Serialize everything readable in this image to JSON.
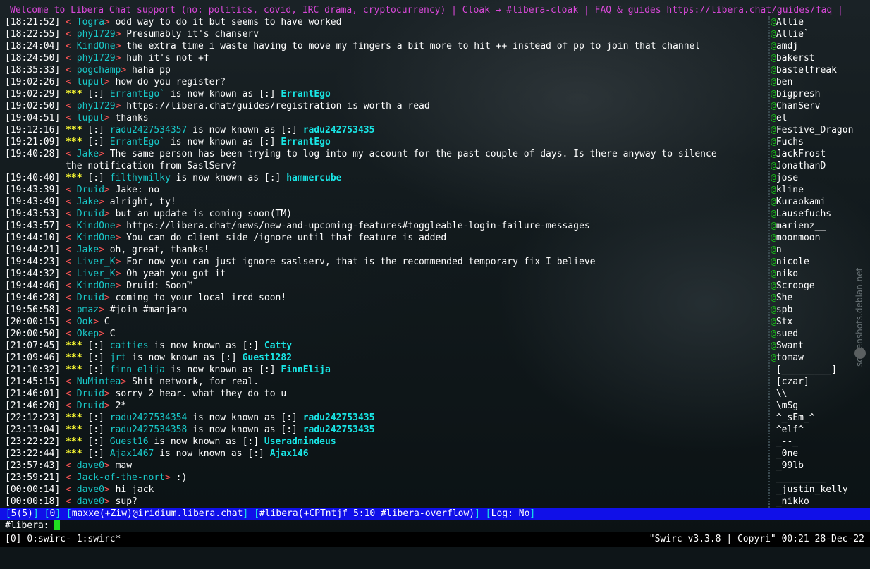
{
  "topic": "Welcome to Libera Chat support (no: politics, covid, IRC drama, cryptocurrency) | Cloak → #libera-cloak | FAQ & guides https://libera.chat/guides/faq |",
  "messages": [
    {
      "ts": "[18:21:52]",
      "kind": "msg",
      "nick": "Togra",
      "text": "odd way to do it but seems to have worked"
    },
    {
      "ts": "[18:22:55]",
      "kind": "msg",
      "nick": "phy1729",
      "text": "Presumably it's chanserv"
    },
    {
      "ts": "[18:24:04]",
      "kind": "msg",
      "nick": "KindOne",
      "text": "the extra time i waste having to move my fingers a bit more to hit ++ instead of pp to join that channel"
    },
    {
      "ts": "[18:24:50]",
      "kind": "msg",
      "nick": "phy1729",
      "text": "huh it's not +f"
    },
    {
      "ts": "[18:35:33]",
      "kind": "msg",
      "nick": "pogchamp",
      "text": "haha pp"
    },
    {
      "ts": "[19:02:26]",
      "kind": "msg",
      "nick": "lupul",
      "text": "how do you register?"
    },
    {
      "ts": "[19:02:29]",
      "kind": "nickchange",
      "old": "ErrantEgo`",
      "new": "ErrantEgo"
    },
    {
      "ts": "[19:02:50]",
      "kind": "msg",
      "nick": "phy1729",
      "text": "https://libera.chat/guides/registration is worth a read"
    },
    {
      "ts": "[19:04:51]",
      "kind": "msg",
      "nick": "lupul",
      "text": "thanks"
    },
    {
      "ts": "[19:12:16]",
      "kind": "nickchange",
      "old": "radu2427534357",
      "new": "radu242753435"
    },
    {
      "ts": "[19:21:09]",
      "kind": "nickchange",
      "old": "ErrantEgo`",
      "new": "ErrantEgo"
    },
    {
      "ts": "[19:40:28]",
      "kind": "msg",
      "nick": "Jake",
      "text": "The same person has been trying to log into my account for the past couple of days. Is there anyway to silence"
    },
    {
      "ts": "",
      "kind": "cont",
      "text": "the notification from SaslServ?"
    },
    {
      "ts": "[19:40:40]",
      "kind": "nickchange",
      "old": "filthymilky",
      "new": "hammercube"
    },
    {
      "ts": "[19:43:39]",
      "kind": "msg",
      "nick": "Druid",
      "text": "Jake: no"
    },
    {
      "ts": "[19:43:49]",
      "kind": "msg",
      "nick": "Jake",
      "text": "alright, ty!"
    },
    {
      "ts": "[19:43:53]",
      "kind": "msg",
      "nick": "Druid",
      "text": "but an update is coming soon(TM)"
    },
    {
      "ts": "[19:43:57]",
      "kind": "msg",
      "nick": "KindOne",
      "text": "https://libera.chat/news/new-and-upcoming-features#toggleable-login-failure-messages"
    },
    {
      "ts": "[19:44:10]",
      "kind": "msg",
      "nick": "KindOne",
      "text": "You can do client side /ignore until that feature is added"
    },
    {
      "ts": "[19:44:21]",
      "kind": "msg",
      "nick": "Jake",
      "text": "oh, great, thanks!"
    },
    {
      "ts": "[19:44:23]",
      "kind": "msg",
      "nick": "Liver_K",
      "text": "For now you can just ignore saslserv, that is the recommended temporary fix I believe"
    },
    {
      "ts": "[19:44:32]",
      "kind": "msg",
      "nick": "Liver_K",
      "text": "Oh yeah you got it"
    },
    {
      "ts": "[19:44:46]",
      "kind": "msg",
      "nick": "KindOne",
      "text": "Druid: Soon™"
    },
    {
      "ts": "[19:46:28]",
      "kind": "msg",
      "nick": "Druid",
      "text": "coming to your local ircd soon!"
    },
    {
      "ts": "[19:56:58]",
      "kind": "msg",
      "nick": "pmaz",
      "text": "#join #manjaro"
    },
    {
      "ts": "[20:00:15]",
      "kind": "msg",
      "nick": "Ook",
      "text": "C"
    },
    {
      "ts": "[20:00:50]",
      "kind": "msg",
      "nick": "Okep",
      "text": "C"
    },
    {
      "ts": "[21:07:45]",
      "kind": "nickchange",
      "old": "catties",
      "new": "Catty"
    },
    {
      "ts": "[21:09:46]",
      "kind": "nickchange",
      "old": "jrt",
      "new": "Guest1282"
    },
    {
      "ts": "[21:10:32]",
      "kind": "nickchange",
      "old": "finn_elija",
      "new": "FinnElija"
    },
    {
      "ts": "[21:45:15]",
      "kind": "msg",
      "nick": "NuMintea",
      "text": "Shit network, for real."
    },
    {
      "ts": "[21:46:01]",
      "kind": "msg",
      "nick": "Druid",
      "text": "sorry 2 hear. what they do to u"
    },
    {
      "ts": "[21:46:20]",
      "kind": "msg",
      "nick": "Druid",
      "text": "2*"
    },
    {
      "ts": "[22:12:23]",
      "kind": "nickchange",
      "old": "radu2427534354",
      "new": "radu242753435"
    },
    {
      "ts": "[23:13:04]",
      "kind": "nickchange",
      "old": "radu2427534358",
      "new": "radu242753435"
    },
    {
      "ts": "[23:22:22]",
      "kind": "nickchange",
      "old": "Guest16",
      "new": "Useradmindeus"
    },
    {
      "ts": "[23:22:44]",
      "kind": "nickchange",
      "old": "Ajax1467",
      "new": "Ajax146"
    },
    {
      "ts": "[23:57:43]",
      "kind": "msg",
      "nick": "dave0",
      "text": "maw"
    },
    {
      "ts": "[23:59:21]",
      "kind": "msg",
      "nick": "Jack-of-the-nort",
      "text": ":)"
    },
    {
      "ts": "[00:00:14]",
      "kind": "msg",
      "nick": "dave0",
      "text": "hi jack"
    },
    {
      "ts": "[00:00:18]",
      "kind": "msg",
      "nick": "dave0",
      "text": "sup?"
    }
  ],
  "nickchange_strings": {
    "stars": "***",
    "tag": "[:]",
    "middle": "is now known as"
  },
  "nicklist": [
    {
      "prefix": "@",
      "name": "Allie"
    },
    {
      "prefix": "@",
      "name": "Allie`"
    },
    {
      "prefix": "@",
      "name": "amdj"
    },
    {
      "prefix": "@",
      "name": "bakerst"
    },
    {
      "prefix": "@",
      "name": "bastelfreak"
    },
    {
      "prefix": "@",
      "name": "ben"
    },
    {
      "prefix": "@",
      "name": "bigpresh"
    },
    {
      "prefix": "@",
      "name": "ChanServ"
    },
    {
      "prefix": "@",
      "name": "el"
    },
    {
      "prefix": "@",
      "name": "Festive_Dragon"
    },
    {
      "prefix": "@",
      "name": "Fuchs"
    },
    {
      "prefix": "@",
      "name": "JackFrost"
    },
    {
      "prefix": "@",
      "name": "JonathanD"
    },
    {
      "prefix": "@",
      "name": "jose"
    },
    {
      "prefix": "@",
      "name": "kline"
    },
    {
      "prefix": "@",
      "name": "Kuraokami"
    },
    {
      "prefix": "@",
      "name": "Lausefuchs"
    },
    {
      "prefix": "@",
      "name": "marienz__"
    },
    {
      "prefix": "@",
      "name": "moonmoon"
    },
    {
      "prefix": "@",
      "name": "n"
    },
    {
      "prefix": "@",
      "name": "nicole"
    },
    {
      "prefix": "@",
      "name": "niko"
    },
    {
      "prefix": "@",
      "name": "Scrooge"
    },
    {
      "prefix": "@",
      "name": "She"
    },
    {
      "prefix": "@",
      "name": "spb"
    },
    {
      "prefix": "@",
      "name": "Stx"
    },
    {
      "prefix": "@",
      "name": "sued"
    },
    {
      "prefix": "@",
      "name": "Swant"
    },
    {
      "prefix": "@",
      "name": "tomaw"
    },
    {
      "prefix": " ",
      "name": "[_________]"
    },
    {
      "prefix": " ",
      "name": "[czar]"
    },
    {
      "prefix": " ",
      "name": "\\\\"
    },
    {
      "prefix": " ",
      "name": "\\mSg"
    },
    {
      "prefix": " ",
      "name": "^_sEm_^"
    },
    {
      "prefix": " ",
      "name": "^elf^"
    },
    {
      "prefix": " ",
      "name": "_--_"
    },
    {
      "prefix": " ",
      "name": "_0ne"
    },
    {
      "prefix": " ",
      "name": "_99lb"
    },
    {
      "prefix": " ",
      "name": "_________"
    },
    {
      "prefix": " ",
      "name": "_justin_kelly"
    },
    {
      "prefix": " ",
      "name": "_nikko"
    }
  ],
  "statusbar": {
    "window": "5(5)",
    "act": "0",
    "user": "maxxe(+Ziw)@iridium.libera.chat",
    "channel": "#libera(+CPTntjf 5:10 #libera-overflow)",
    "log": "Log: No"
  },
  "input": {
    "prompt": "#libera:",
    "value": ""
  },
  "tmux": {
    "session": "[0]",
    "windows": "0:swirc- 1:swirc*",
    "right": "\"Swirc v3.3.8 | Copyri\" 00:21 28-Dec-22"
  },
  "watermark": "screenshots.debian.net",
  "colors": {
    "topic": "#d848d8",
    "bracket": "#ff5555",
    "nick": "#19c9c9",
    "stars": "#ffff33",
    "op": "#18b818",
    "statusbg": "#1010e8",
    "cursor": "#20e020"
  }
}
